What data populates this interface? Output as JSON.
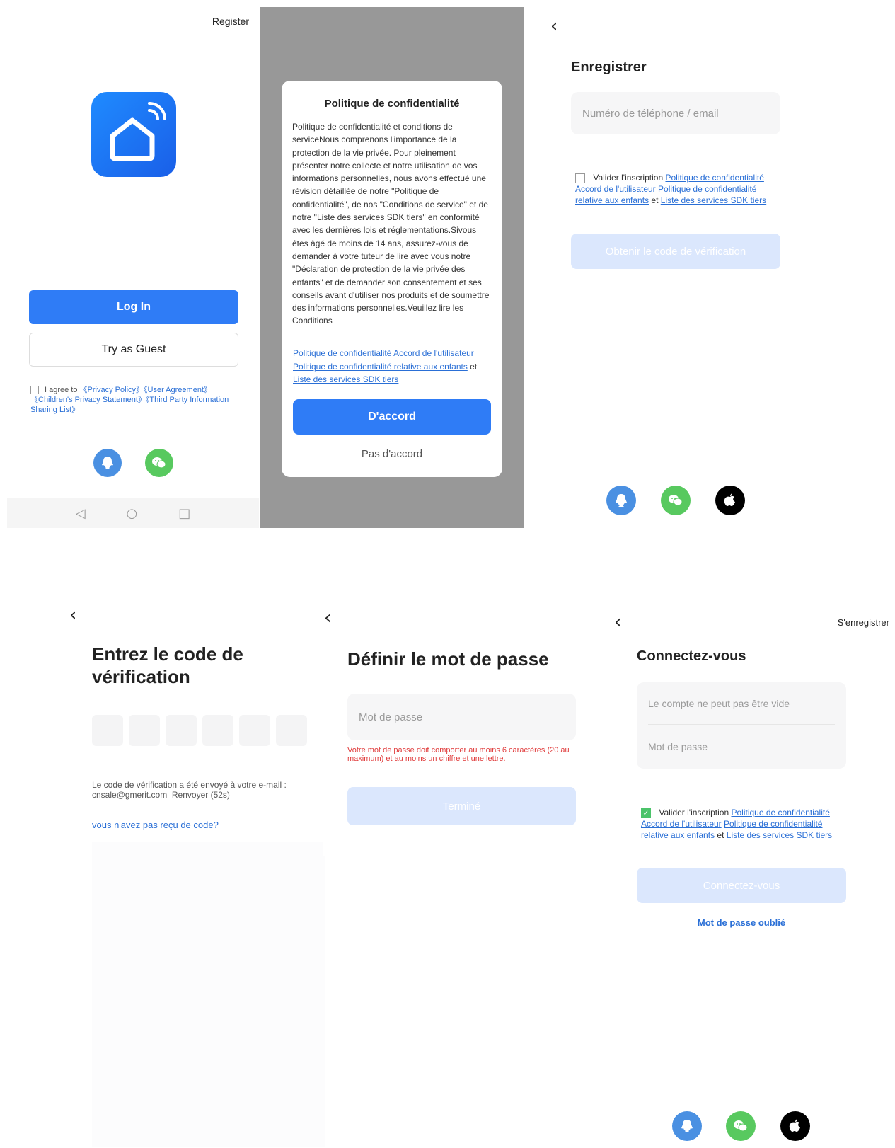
{
  "p1": {
    "register": "Register",
    "login": "Log In",
    "guest": "Try as Guest",
    "agree_prefix": "I agree to",
    "agree_links": "《Privacy Policy》《User Agreement》《Children's Privacy Statement》《Third Party Information Sharing List》",
    "nav_back": "◁",
    "nav_home": "○",
    "nav_recent": "□"
  },
  "p2": {
    "title": "Politique de confidentialité",
    "body": "Politique de confidentialité et conditions de serviceNous comprenons l'importance de la protection de la vie privée. Pour pleinement présenter notre collecte et notre utilisation de vos informations personnelles, nous avons effectué une révision détaillée de notre \"Politique de confidentialité\", de nos \"Conditions de service\" et de notre \"Liste des services SDK tiers\" en conformité avec les dernières lois et réglementations.Sivous êtes âgé de moins de 14 ans, assurez-vous de demander à votre tuteur de lire avec vous notre \"Déclaration de protection de la vie privée des enfants\" et de demander son consentement et ses conseils avant d'utiliser nos produits et de soumettre des informations personnelles.Veuillez lire les Conditions",
    "link1": "Politique de confidentialité",
    "link2": "Accord de l'utilisateur",
    "link3": "Politique de confidentialité relative aux enfants",
    "et": "et",
    "link4": "Liste des services SDK tiers",
    "accept": "D'accord",
    "decline": "Pas d'accord"
  },
  "p3": {
    "back": "‹",
    "title": "Enregistrer",
    "placeholder": "Numéro de téléphone / email",
    "consent_prefix": "Valider l'inscription",
    "link1": "Politique de confidentialité",
    "link2": "Accord de l'utilisateur",
    "link3": "Politique de confidentialité relative aux enfants",
    "et": "et",
    "link4": "Liste des services SDK tiers",
    "button": "Obtenir le code de vérification"
  },
  "p4": {
    "back": "‹",
    "title": "Entrez le code de vérification",
    "info": "Le code de vérification a été envoyé à votre e-mail : cnsale@gmerit.com",
    "resend": "Renvoyer (52s)",
    "no_code": "vous n'avez pas reçu de code?"
  },
  "p5": {
    "back": "‹",
    "title": "Définir le mot de passe",
    "placeholder": "Mot de passe",
    "error": "Votre mot de passe doit comporter au moins 6 caractères (20 au maximum) et au moins un chiffre et une lettre.",
    "button": "Terminé"
  },
  "p6": {
    "back": "‹",
    "register": "S'enregistrer",
    "title": "Connectez-vous",
    "account_placeholder": "Le compte ne peut pas être vide",
    "password_placeholder": "Mot de passe",
    "consent_prefix": "Valider l'inscription",
    "link1": "Politique de confidentialité",
    "link2": "Accord de l'utilisateur",
    "link3": "Politique de confidentialité relative aux enfants",
    "et": "et",
    "link4": "Liste des services SDK tiers",
    "button": "Connectez-vous",
    "forgot": "Mot de passe oublié"
  },
  "colors": {
    "primary": "#2f7cf6",
    "disabled": "#dbe7fd",
    "qq": "#4a90e2",
    "wechat": "#58c95f",
    "apple": "#000000",
    "error": "#e03b3b"
  },
  "icons": [
    "app-home-icon",
    "qq-icon",
    "wechat-icon",
    "apple-icon",
    "back-arrow-icon"
  ]
}
